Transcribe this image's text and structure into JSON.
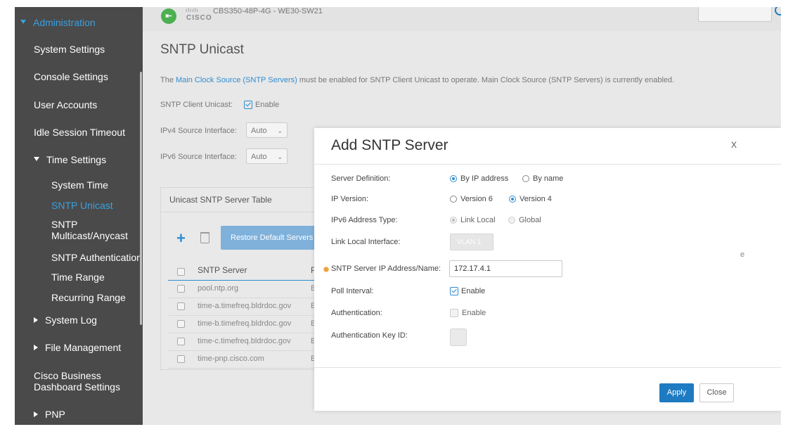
{
  "colors": {
    "sidebar_bg": "#4a4a4a",
    "accent": "#2f8cd1",
    "primary_button": "#1f7bc1",
    "required_marker": "#e8a040"
  },
  "header": {
    "device_name": "CBS350-48P-4G - WE30-SW21",
    "logo_dots": "ılıılı",
    "logo_text": "CISCO",
    "collapse_icon": "⇤"
  },
  "sidebar": {
    "administration": "Administration",
    "system_settings": "System Settings",
    "console_settings": "Console Settings",
    "user_accounts": "User Accounts",
    "idle_session_timeout": "Idle Session Timeout",
    "time_settings": "Time Settings",
    "system_time": "System Time",
    "sntp_unicast": "SNTP Unicast",
    "sntp_multicast_1": "SNTP",
    "sntp_multicast_2": "Multicast/Anycast",
    "sntp_authentication": "SNTP Authentication",
    "time_range": "Time Range",
    "recurring_range": "Recurring Range",
    "system_log": "System Log",
    "file_management": "File Management",
    "cbd_settings_1": "Cisco Business",
    "cbd_settings_2": "Dashboard Settings",
    "pnp": "PNP"
  },
  "page": {
    "title": "SNTP Unicast",
    "notice_prefix": "The ",
    "notice_link": "Main Clock Source (SNTP Servers)",
    "notice_suffix": " must be enabled for SNTP Client Unicast to operate. Main Clock Source (SNTP Servers) is currently enabled.",
    "client_unicast_label": "SNTP Client Unicast:",
    "client_unicast_value": "Enable",
    "ipv4_label": "IPv4 Source Interface:",
    "ipv4_value": "Auto",
    "ipv6_label": "IPv6 Source Interface:",
    "ipv6_value": "Auto"
  },
  "table": {
    "title": "Unicast SNTP Server Table",
    "restore_button": "Restore Default Servers",
    "columns": [
      "SNTP Server",
      "P"
    ],
    "rows": [
      {
        "server": "pool.ntp.org",
        "c2": "E"
      },
      {
        "server": "time-a.timefreq.bldrdoc.gov",
        "c2": "E"
      },
      {
        "server": "time-b.timefreq.bldrdoc.gov",
        "c2": "E"
      },
      {
        "server": "time-c.timefreq.bldrdoc.gov",
        "c2": "E"
      },
      {
        "server": "time-pnp.cisco.com",
        "c2": "E"
      }
    ],
    "cutoff_header": "e"
  },
  "modal": {
    "title": "Add SNTP Server",
    "close_x": "X",
    "server_definition_label": "Server Definition:",
    "by_ip": "By IP address",
    "by_name": "By name",
    "server_definition_selected": "By IP address",
    "ip_version_label": "IP Version:",
    "version6": "Version 6",
    "version4": "Version 4",
    "ip_version_selected": "Version 4",
    "ipv6_type_label": "IPv6 Address Type:",
    "link_local": "Link Local",
    "global": "Global",
    "link_local_interface_label": "Link Local Interface:",
    "link_local_interface_value": "VLAN 1",
    "server_ip_label": "SNTP Server IP Address/Name:",
    "server_ip_value": "172.17.4.1",
    "poll_interval_label": "Poll Interval:",
    "poll_interval_value": "Enable",
    "authentication_label": "Authentication:",
    "authentication_value": "Enable",
    "auth_key_label": "Authentication Key ID:",
    "apply_button": "Apply",
    "close_button": "Close"
  }
}
